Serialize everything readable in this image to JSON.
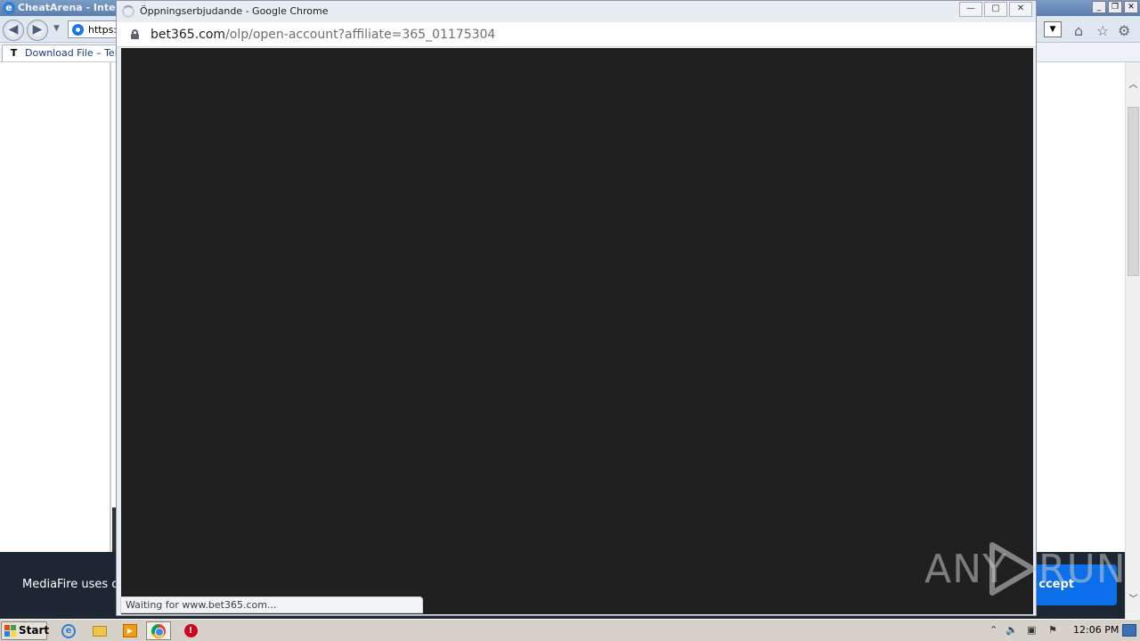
{
  "ie": {
    "title": "CheatArena - Intern",
    "address_text": "https:",
    "tab_label": "Download File – Tele",
    "tab_icon_letter": "T"
  },
  "cookie_banner": {
    "text": "MediaFire uses c",
    "accept_label": "ccept"
  },
  "chrome_popup": {
    "title": "Öppningserbjudande - Google Chrome",
    "url_host": "bet365.com",
    "url_path": "/olp/open-account?affiliate=365_01175304",
    "status": "Waiting for www.bet365.com..."
  },
  "watermark": {
    "left": "ANY",
    "right": "RUN"
  },
  "taskbar": {
    "start_label": "Start",
    "clock": "12:06 PM"
  },
  "colors": {
    "content_bg": "#202020",
    "banner_bg": "#1d2633",
    "accept_bg": "#0a6fe8"
  }
}
